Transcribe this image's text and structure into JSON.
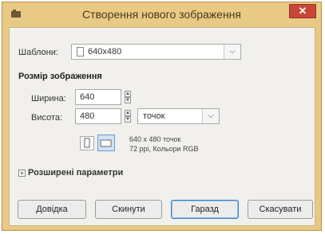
{
  "window": {
    "title": "Створення нового зображення",
    "close_label": "✕"
  },
  "template": {
    "label": "Шаблони:",
    "value": "640x480"
  },
  "image_size": {
    "heading": "Розмір зображення",
    "width_label": "Ширина:",
    "width_value": "640",
    "height_label": "Висота:",
    "height_value": "480",
    "unit_value": "точок",
    "info_line1": "640 x 480 точок",
    "info_line2": "72 ppi, Кольори RGB"
  },
  "advanced": {
    "label": "Розширені параметри"
  },
  "buttons": {
    "help": "Довідка",
    "reset": "Скинути",
    "ok": "Гаразд",
    "cancel": "Скасувати"
  },
  "colors": {
    "frame": "#e9ca84",
    "close": "#c7463a",
    "client": "#f2f0ed",
    "default_button_border": "#3d7fc1"
  },
  "icons": [
    "app-icon",
    "close-icon",
    "document-icon",
    "chevron-down-icon",
    "portrait-icon",
    "landscape-icon",
    "expand-icon"
  ]
}
